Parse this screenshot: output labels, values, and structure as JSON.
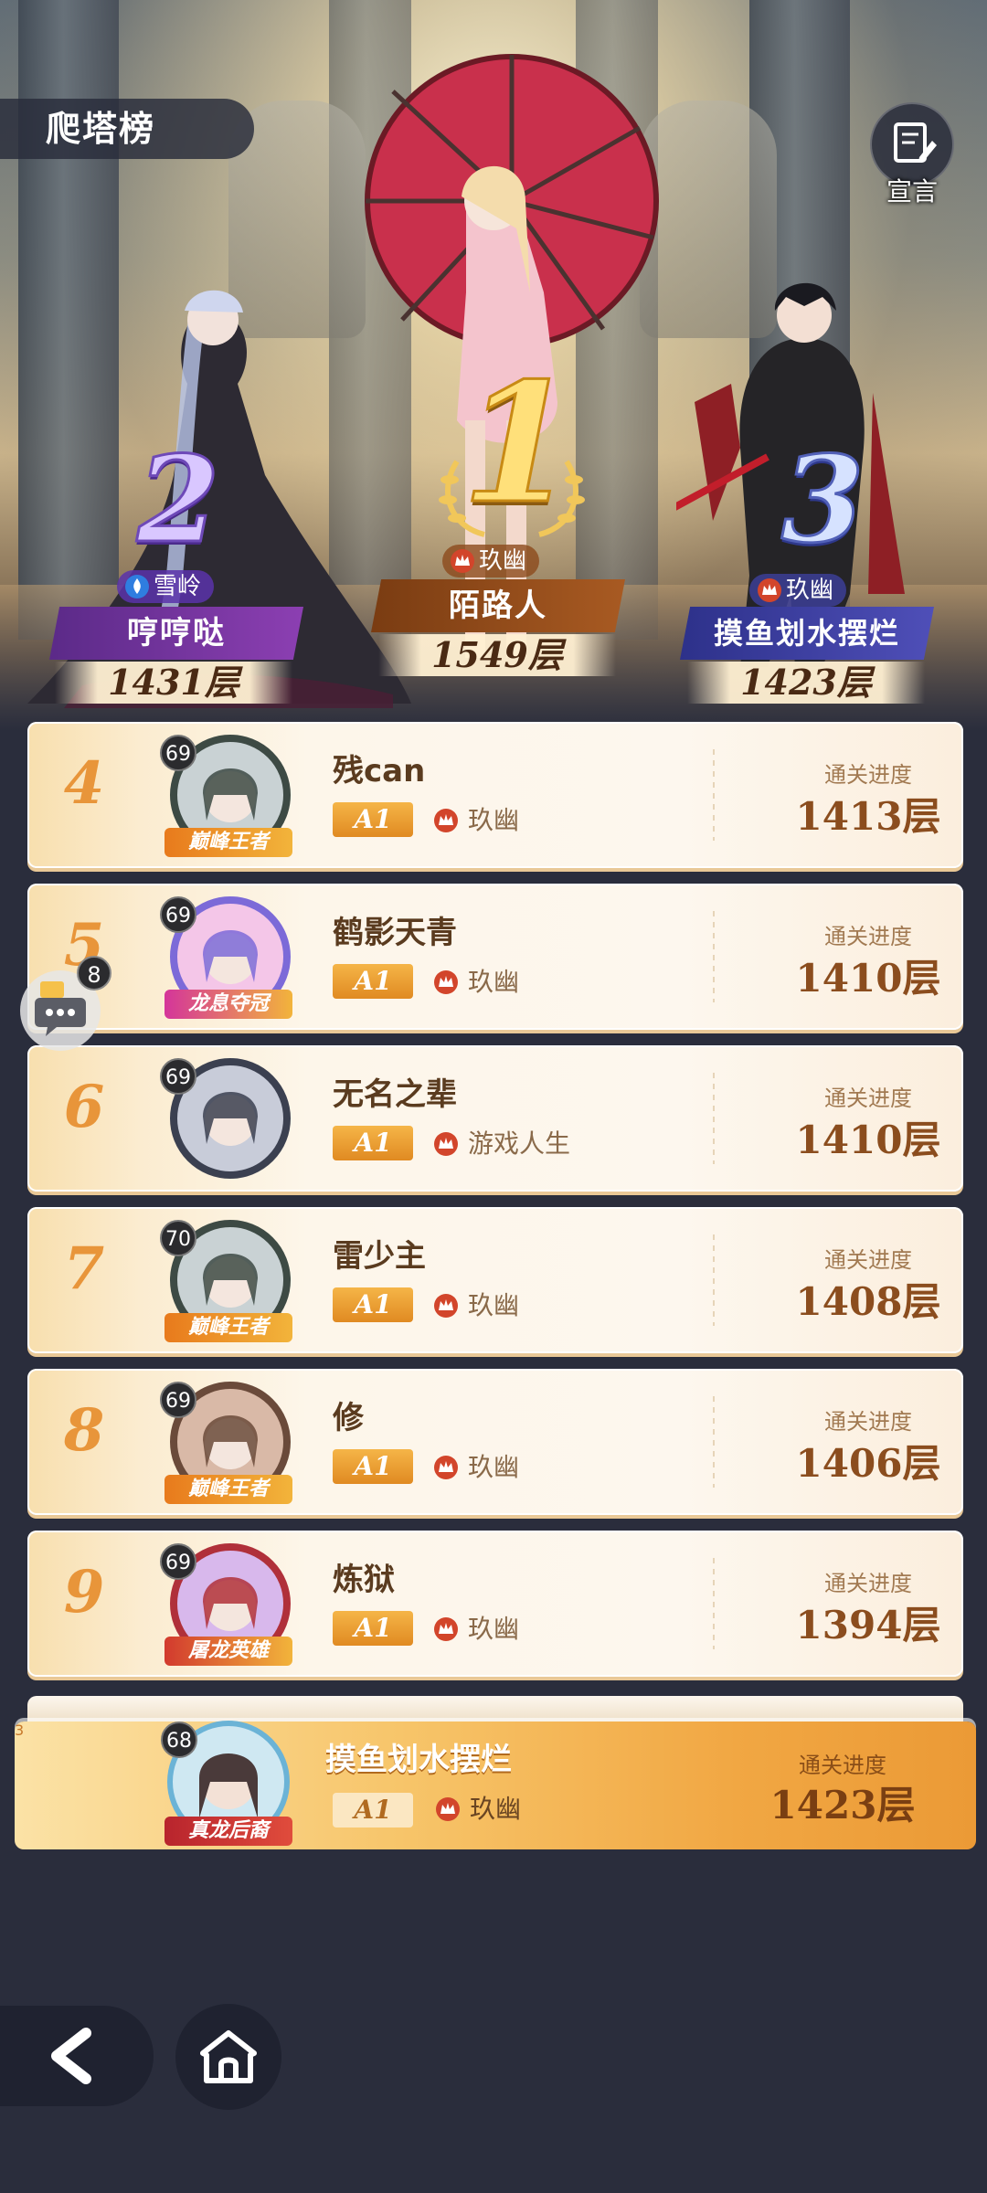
{
  "header": {
    "title": "爬塔榜",
    "declaration_label": "宣言"
  },
  "podium": [
    {
      "rank": "2",
      "name": "哼哼哒",
      "guild": "雪岭",
      "floors": "1431层"
    },
    {
      "rank": "1",
      "name": "陌路人",
      "guild": "玖幽",
      "floors": "1549层"
    },
    {
      "rank": "3",
      "name": "摸鱼划水摆烂",
      "guild": "玖幽",
      "floors": "1423层"
    }
  ],
  "progress_label": "通关进度",
  "rows": [
    {
      "rank": "4",
      "level": "69",
      "frame": "巅峰王者",
      "name": "残can",
      "badge": "A1",
      "guild": "玖幽",
      "floors": "1413层"
    },
    {
      "rank": "5",
      "level": "69",
      "frame": "龙息夺冠",
      "name": "鹤影天青",
      "badge": "A1",
      "guild": "玖幽",
      "floors": "1410层"
    },
    {
      "rank": "6",
      "level": "69",
      "frame": "",
      "name": "无名之辈",
      "badge": "A1",
      "guild": "游戏人生",
      "floors": "1410层"
    },
    {
      "rank": "7",
      "level": "70",
      "frame": "巅峰王者",
      "name": "雷少主",
      "badge": "A1",
      "guild": "玖幽",
      "floors": "1408层"
    },
    {
      "rank": "8",
      "level": "69",
      "frame": "巅峰王者",
      "name": "修",
      "badge": "A1",
      "guild": "玖幽",
      "floors": "1406层"
    },
    {
      "rank": "9",
      "level": "69",
      "frame": "屠龙英雄",
      "name": "炼狱",
      "badge": "A1",
      "guild": "玖幽",
      "floors": "1394层"
    }
  ],
  "self": {
    "rank": "3",
    "level": "68",
    "frame": "真龙后裔",
    "name": "摸鱼划水摆烂",
    "badge": "A1",
    "guild": "玖幽",
    "floors": "1423层"
  },
  "chat": {
    "badge": "8"
  },
  "colors": {
    "accent": "#e8953a",
    "guild_red": "#d2452b",
    "podium_purple": "#6a2d8f",
    "podium_gold": "#8c4a1c",
    "podium_blue": "#3a3d8f"
  }
}
